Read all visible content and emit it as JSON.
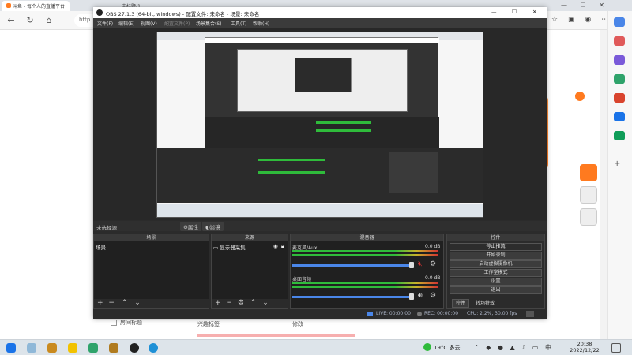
{
  "browser": {
    "tabs": [
      {
        "label": "斗鱼 - 每个人的直播平台"
      },
      {
        "label": "未标题-1"
      }
    ],
    "address_prefix": "http"
  },
  "obs": {
    "title": "OBS 27.1.3 (64-bit, windows) - 配置文件: 未命名 - 场景: 未命名",
    "menu": [
      "文件(F)",
      "编辑(E)",
      "视图(V)",
      "配置文件(P)",
      "场景集合(S)",
      "工具(T)",
      "帮助(H)"
    ],
    "status_left": "未选择源",
    "props_label": "属性",
    "filters_label": "滤镜",
    "scenes": {
      "title": "场景",
      "items": [
        "场景"
      ]
    },
    "sources": {
      "title": "来源",
      "items": [
        "显示器采集"
      ]
    },
    "mixer": {
      "title": "混音器",
      "channels": [
        {
          "name": "麦克风/Aux",
          "db": "0.0 dB"
        },
        {
          "name": "桌面音频",
          "db": "0.0 dB"
        }
      ]
    },
    "controls": {
      "title": "控件",
      "buttons": [
        "停止推流",
        "开始录制",
        "启动虚拟摄像机",
        "工作室模式",
        "设置",
        "退出"
      ],
      "tabs": [
        "控件",
        "转场特效"
      ]
    },
    "statusbar": {
      "live": "LIVE: 00:00:00",
      "rec": "REC: 00:00:00",
      "cpu": "CPU: 2.2%, 30.00 fps"
    }
  },
  "page_fragments": {
    "item1": "兴趣标签",
    "item2": "修改",
    "item3": "房间标题"
  },
  "taskbar": {
    "weather": "19°C 多云",
    "time": "20:38",
    "date": "2022/12/22"
  },
  "colors": {
    "accent_orange": "#ff7a1f",
    "obs_dark": "#2b2b2b",
    "meter_green": "#2fbb3b",
    "meter_red": "#d23232",
    "slider_blue": "#4a86e8"
  }
}
